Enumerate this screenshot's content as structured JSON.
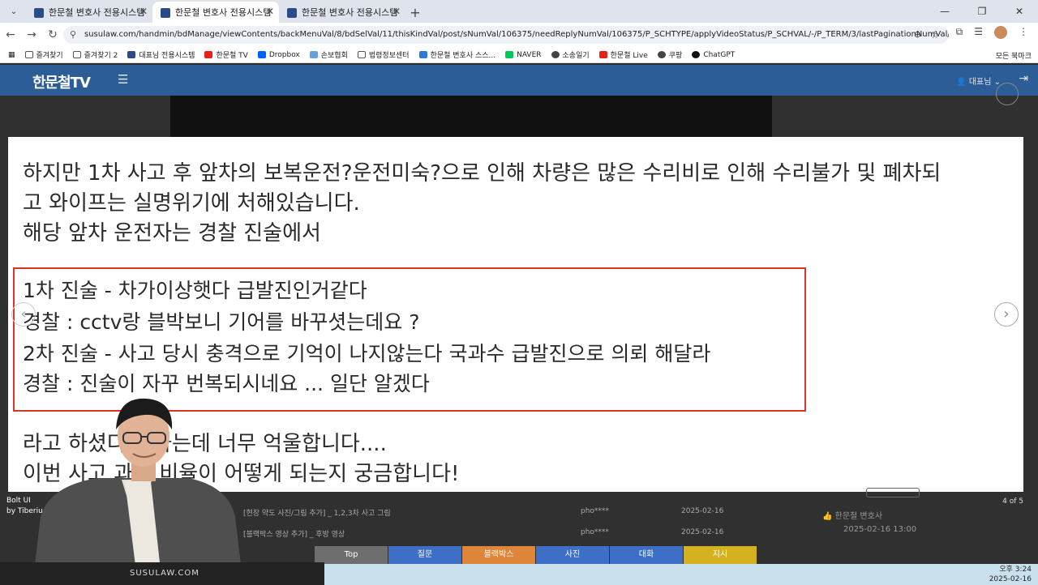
{
  "browser": {
    "tabs": [
      {
        "label": "한문철 변호사 전용시스템",
        "active": false
      },
      {
        "label": "한문철 변호사 전용시스템",
        "active": true
      },
      {
        "label": "한문철 변호사 전용시스템",
        "active": false
      }
    ],
    "url": "susulaw.com/handmin/bdManage/viewContents/backMenuVal/8/bdSelVal/11/thisKindVal/post/sNumVal/106375/needReplyNumVal/106375/P_SCHTYPE/applyVideoStatus/P_SCHVAL/-/P_TERM/3/lastPaginationNumVal/1",
    "bookmarks": [
      "즐겨찾기",
      "즐겨찾기 2",
      "대표님 전용시스템",
      "한문철 TV",
      "Dropbox",
      "손보협회",
      "법령정보센터",
      "한문철 변호사 스스...",
      "NAVER",
      "소송일기",
      "한문철 Live",
      "쿠팡",
      "ChatGPT"
    ],
    "bookmarks_right": "모든 북마크"
  },
  "site": {
    "logo": "한문철TV",
    "user": "대표님"
  },
  "slide": {
    "line1": "하지만 1차 사고 후 앞차의 보복운전?운전미숙?으로 인해 차량은 많은 수리비로 인해 수리불가 및 폐차되",
    "line2": "고 와이프는 실명위기에 처해있습니다.",
    "line3": "해당 앞차 운전자는 경찰 진술에서",
    "quote1": "1차 진술 - 차가이상햇다 급발진인거같다",
    "quote2": "경찰 : cctv랑 블박보니 기어를 바꾸셧는데요 ?",
    "quote3": "2차 진술 - 사고 당시 충격으로 기억이 나지않는다 국과수 급발진으로 의뢰 해달라",
    "quote4": "경찰 : 진술이 자꾸 번복되시네요 ... 일단 알겠다",
    "line4": "라고 하셨다고 하는데 너무 억울합니다....",
    "line5": "이번 사고 과실 비율이 어떻게 되는지 궁금합니다!"
  },
  "credit": {
    "line1": "Bolt UI",
    "line2": "by Tiberiu Neamu"
  },
  "counter": "4 of 5",
  "rows": [
    {
      "title": "[현장 약도 사진/그림 추가] _ 1,2,3차 사고 그림",
      "user": "pho****",
      "date": "2025-02-16"
    },
    {
      "title": "[블랙박스 영상 추가] _ 후방 영상",
      "user": "pho****",
      "date": "2025-02-16"
    }
  ],
  "side_note": {
    "name": "한문철 변호사",
    "time": "2025-02-16 13:00"
  },
  "buttons": [
    {
      "label": "Top",
      "color": "#6e6e6e"
    },
    {
      "label": "질문",
      "color": "#3e6fc7"
    },
    {
      "label": "블랙박스",
      "color": "#e0863a"
    },
    {
      "label": "사진",
      "color": "#3e6fc7"
    },
    {
      "label": "대화",
      "color": "#3e6fc7"
    },
    {
      "label": "지시",
      "color": "#d4b21f"
    }
  ],
  "desk_label": "SUSULAW.COM",
  "clock": {
    "time": "오후 3:24",
    "date": "2025-02-16"
  },
  "colors": {
    "header": "#2d5d97",
    "redbox": "#d9342b"
  }
}
